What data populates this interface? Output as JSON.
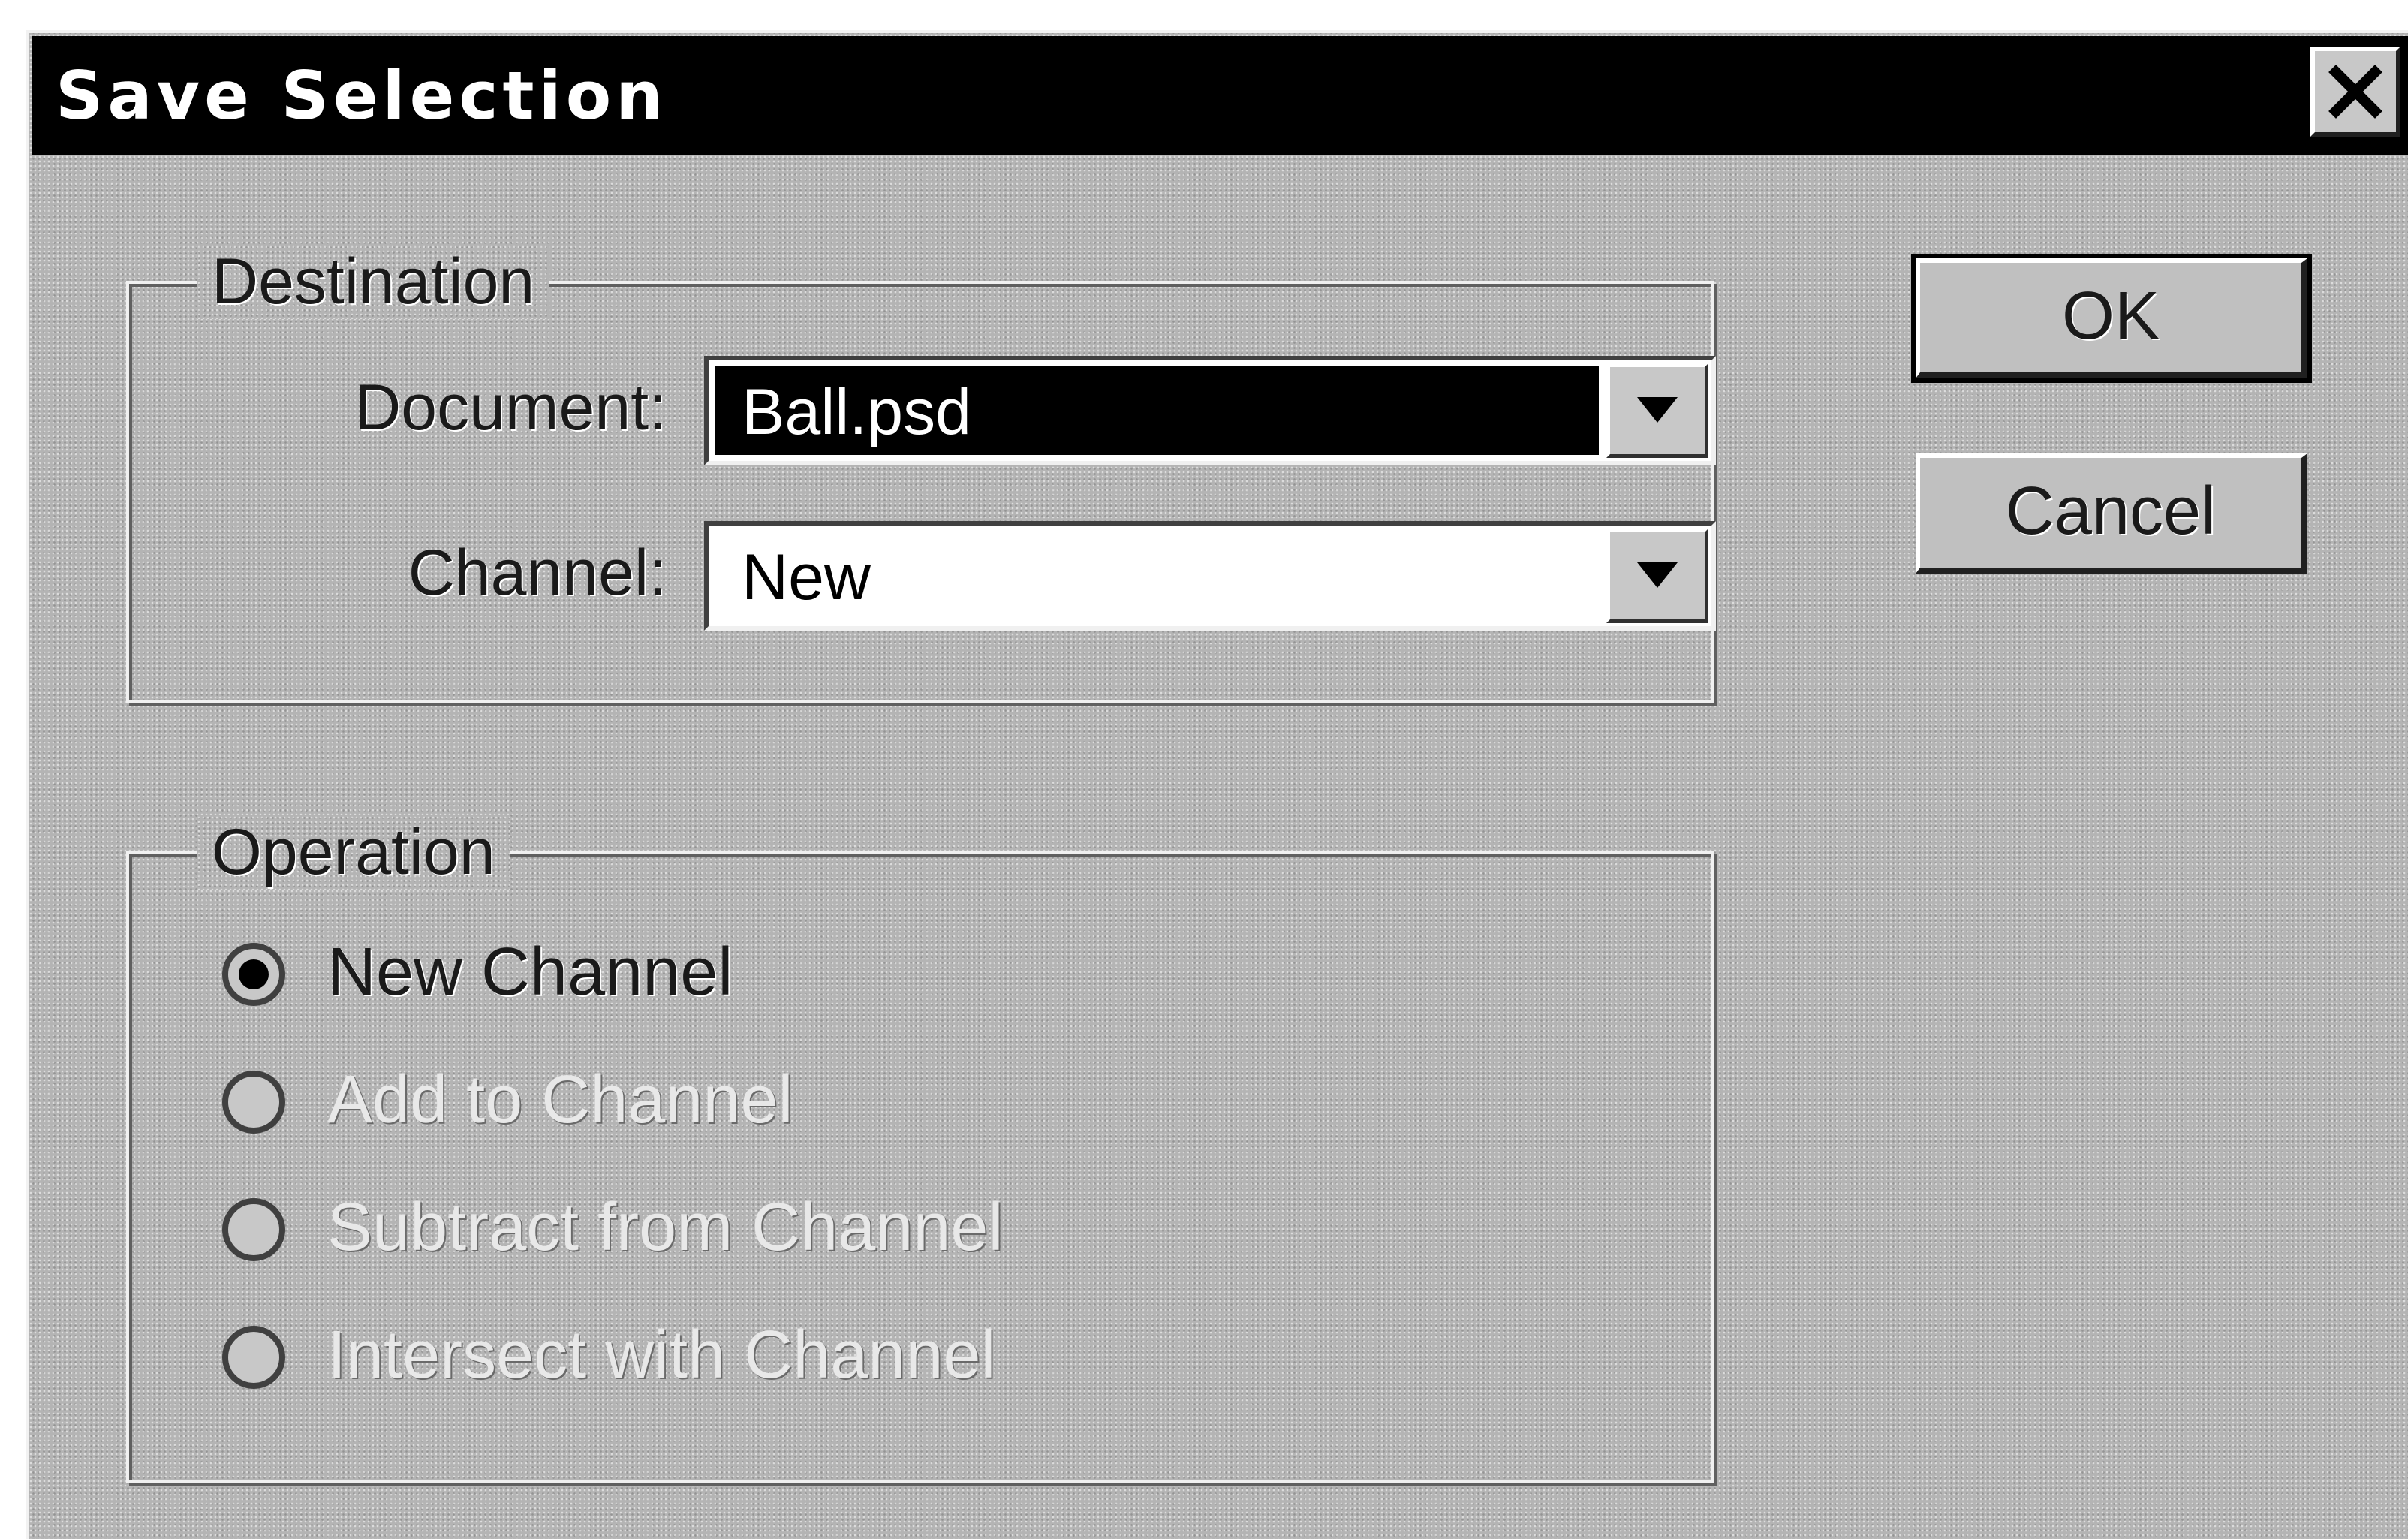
{
  "window": {
    "title": "Save Selection",
    "close_icon": "close-x-icon"
  },
  "destination": {
    "legend": "Destination",
    "document": {
      "label": "Document:",
      "mnemonic": "D",
      "value": "Ball.psd",
      "dropdown_icon": "chevron-down-icon"
    },
    "channel": {
      "label": "Channel:",
      "mnemonic": "C",
      "value": "New",
      "dropdown_icon": "chevron-down-icon"
    }
  },
  "operation": {
    "legend": "Operation",
    "options": [
      {
        "label": "New Channel",
        "selected": true,
        "enabled": true
      },
      {
        "label": "Add to Channel",
        "selected": false,
        "enabled": false
      },
      {
        "label": "Subtract from Channel",
        "selected": false,
        "enabled": false
      },
      {
        "label": "Intersect with Channel",
        "selected": false,
        "enabled": false
      }
    ]
  },
  "buttons": {
    "ok": "OK",
    "cancel": "Cancel"
  },
  "colors": {
    "titlebar": "#000000",
    "title_text": "#ffffff",
    "dialog_face": "#b4b4b4",
    "selection_highlight": "#000000"
  }
}
